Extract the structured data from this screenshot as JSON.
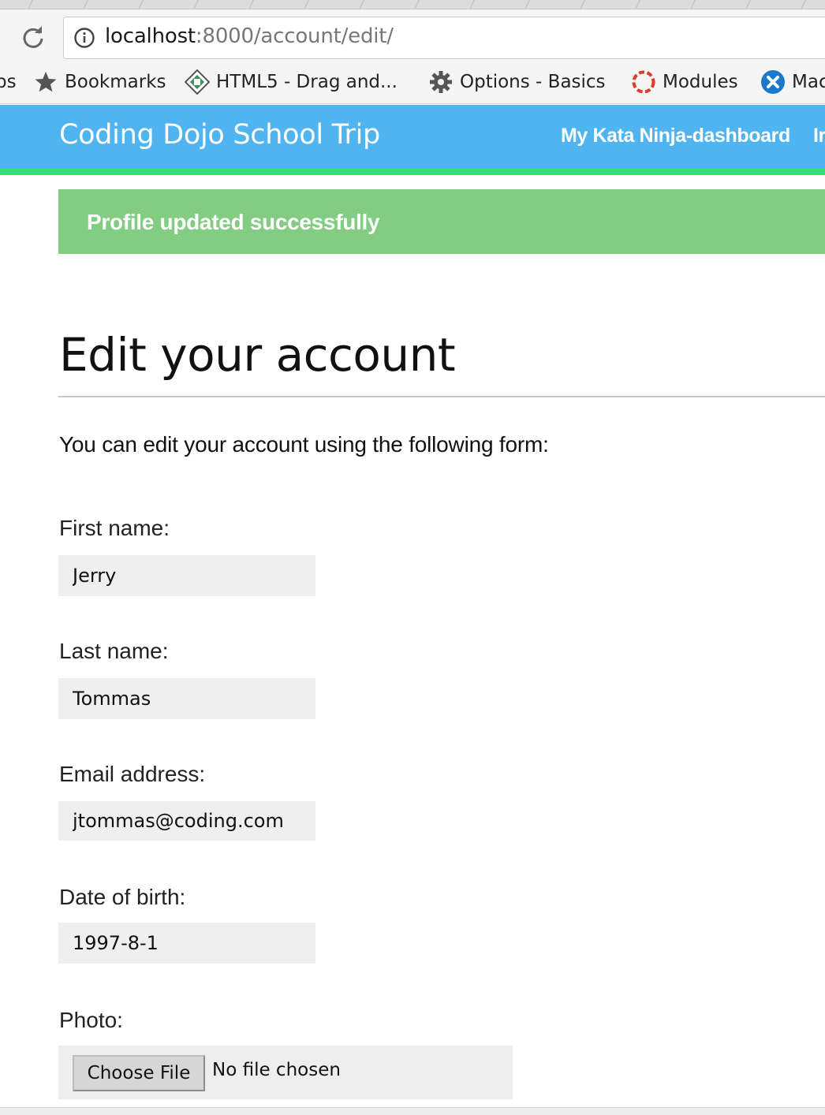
{
  "browser": {
    "url_host": "localhost",
    "url_rest": ":8000/account/edit/",
    "bookmarks": [
      {
        "label": "ps",
        "icon": "fragment"
      },
      {
        "label": "Bookmarks",
        "icon": "star-icon"
      },
      {
        "label": "HTML5 - Drag and...",
        "icon": "html5-icon"
      },
      {
        "label": "Options - Basics",
        "icon": "gear-icon"
      },
      {
        "label": "Modules",
        "icon": "lifebuoy-icon"
      },
      {
        "label": "Mac",
        "icon": "close-circle-icon"
      }
    ]
  },
  "navbar": {
    "brand": "Coding Dojo School Trip",
    "links": [
      "My Kata Ninja-dashboard",
      "Ir"
    ],
    "background": "#4fb4ef",
    "accent": "#2fe07b"
  },
  "alert": {
    "message": "Profile updated successfully",
    "color": "#82cd81"
  },
  "main": {
    "title": "Edit your account",
    "intro": "You can edit your account using the following form:"
  },
  "form": {
    "first_name_label": "First name:",
    "first_name_value": "Jerry",
    "last_name_label": "Last name:",
    "last_name_value": "Tommas",
    "email_label": "Email address:",
    "email_value": "jtommas@coding.com",
    "dob_label": "Date of birth:",
    "dob_value": "1997-8-1",
    "photo_label": "Photo:",
    "photo_button": "Choose File",
    "photo_status": "No file chosen"
  }
}
